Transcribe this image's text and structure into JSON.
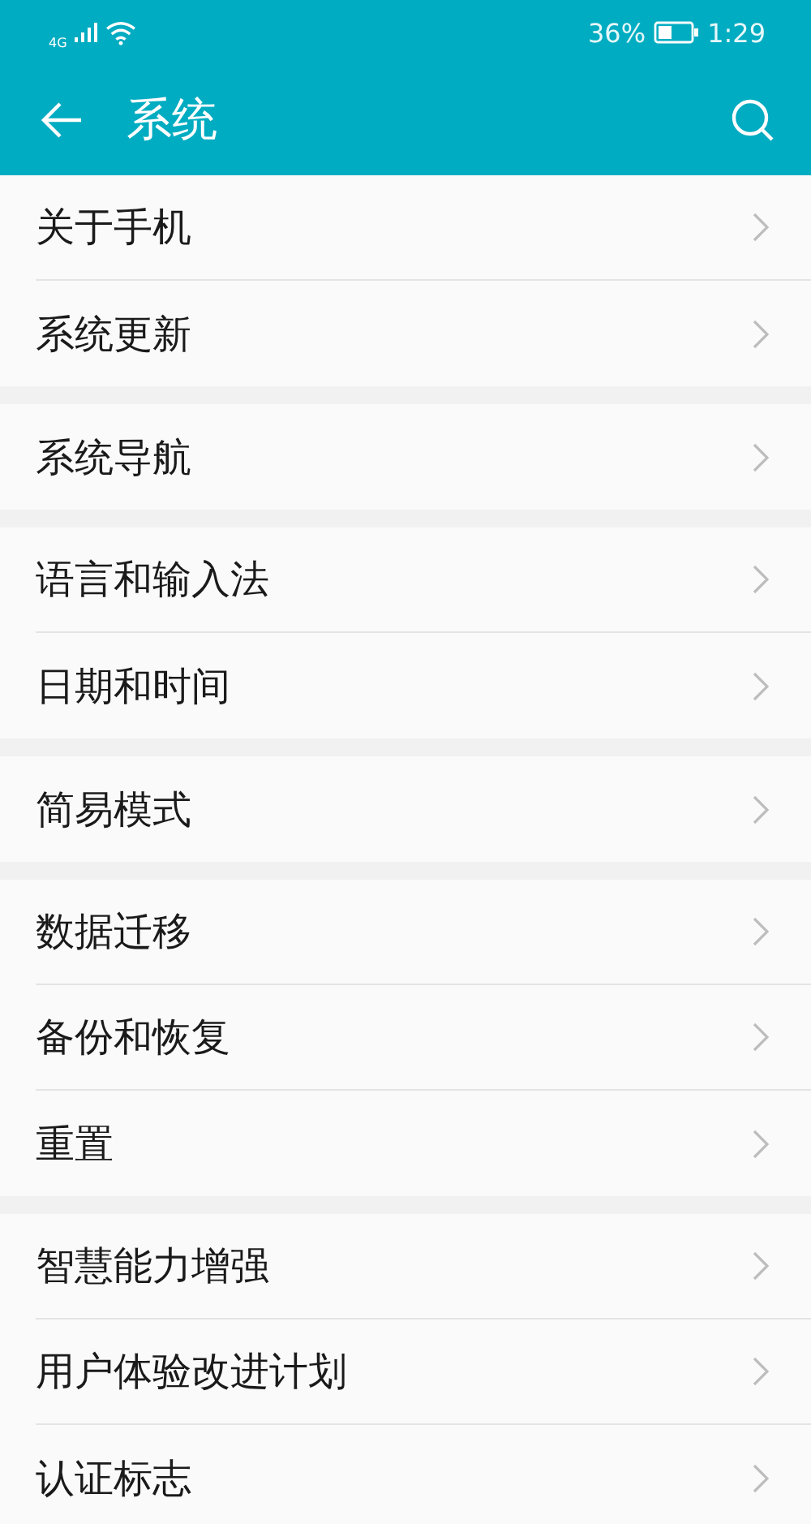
{
  "status_bar": {
    "network": "4G",
    "battery_text": "36%",
    "time": "1:29"
  },
  "header": {
    "title": "系统"
  },
  "groups": [
    {
      "items": [
        {
          "label": "关于手机"
        },
        {
          "label": "系统更新"
        }
      ]
    },
    {
      "items": [
        {
          "label": "系统导航"
        }
      ]
    },
    {
      "items": [
        {
          "label": "语言和输入法"
        },
        {
          "label": "日期和时间"
        }
      ]
    },
    {
      "items": [
        {
          "label": "简易模式"
        }
      ]
    },
    {
      "items": [
        {
          "label": "数据迁移"
        },
        {
          "label": "备份和恢复"
        },
        {
          "label": "重置"
        }
      ]
    },
    {
      "items": [
        {
          "label": "智慧能力增强"
        },
        {
          "label": "用户体验改进计划"
        },
        {
          "label": "认证标志"
        }
      ]
    }
  ]
}
